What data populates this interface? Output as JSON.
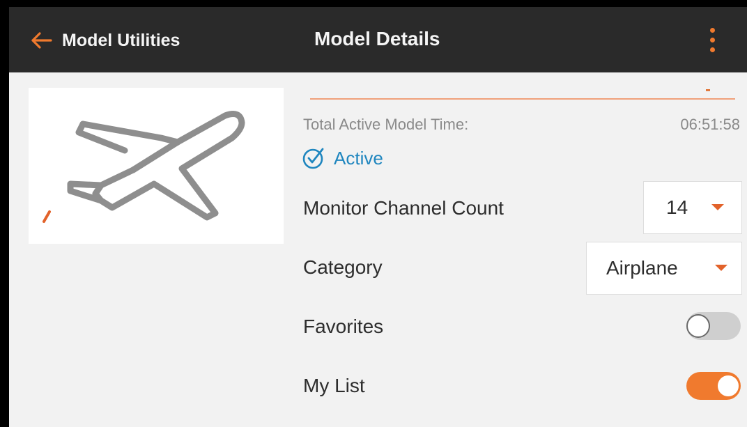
{
  "header": {
    "back_label": "Model Utilities",
    "title": "Model Details",
    "back_icon": "arrow-left-icon",
    "menu_icon": "kebab-menu-icon"
  },
  "model_image": {
    "icon": "airplane-icon"
  },
  "stats": {
    "total_time_label": "Total Active Model Time:",
    "total_time_value": "06:51:58"
  },
  "status": {
    "icon": "check-circle-icon",
    "label": "Active"
  },
  "settings": {
    "monitor_channel_count": {
      "label": "Monitor Channel Count",
      "value": "14"
    },
    "category": {
      "label": "Category",
      "value": "Airplane"
    },
    "favorites": {
      "label": "Favorites",
      "enabled": false
    },
    "my_list": {
      "label": "My List",
      "enabled": true
    }
  },
  "colors": {
    "accent": "#f07a2e",
    "header_bg": "#2a2a2a",
    "status": "#1f86bf",
    "toggle_off": "#cfcfcf"
  }
}
